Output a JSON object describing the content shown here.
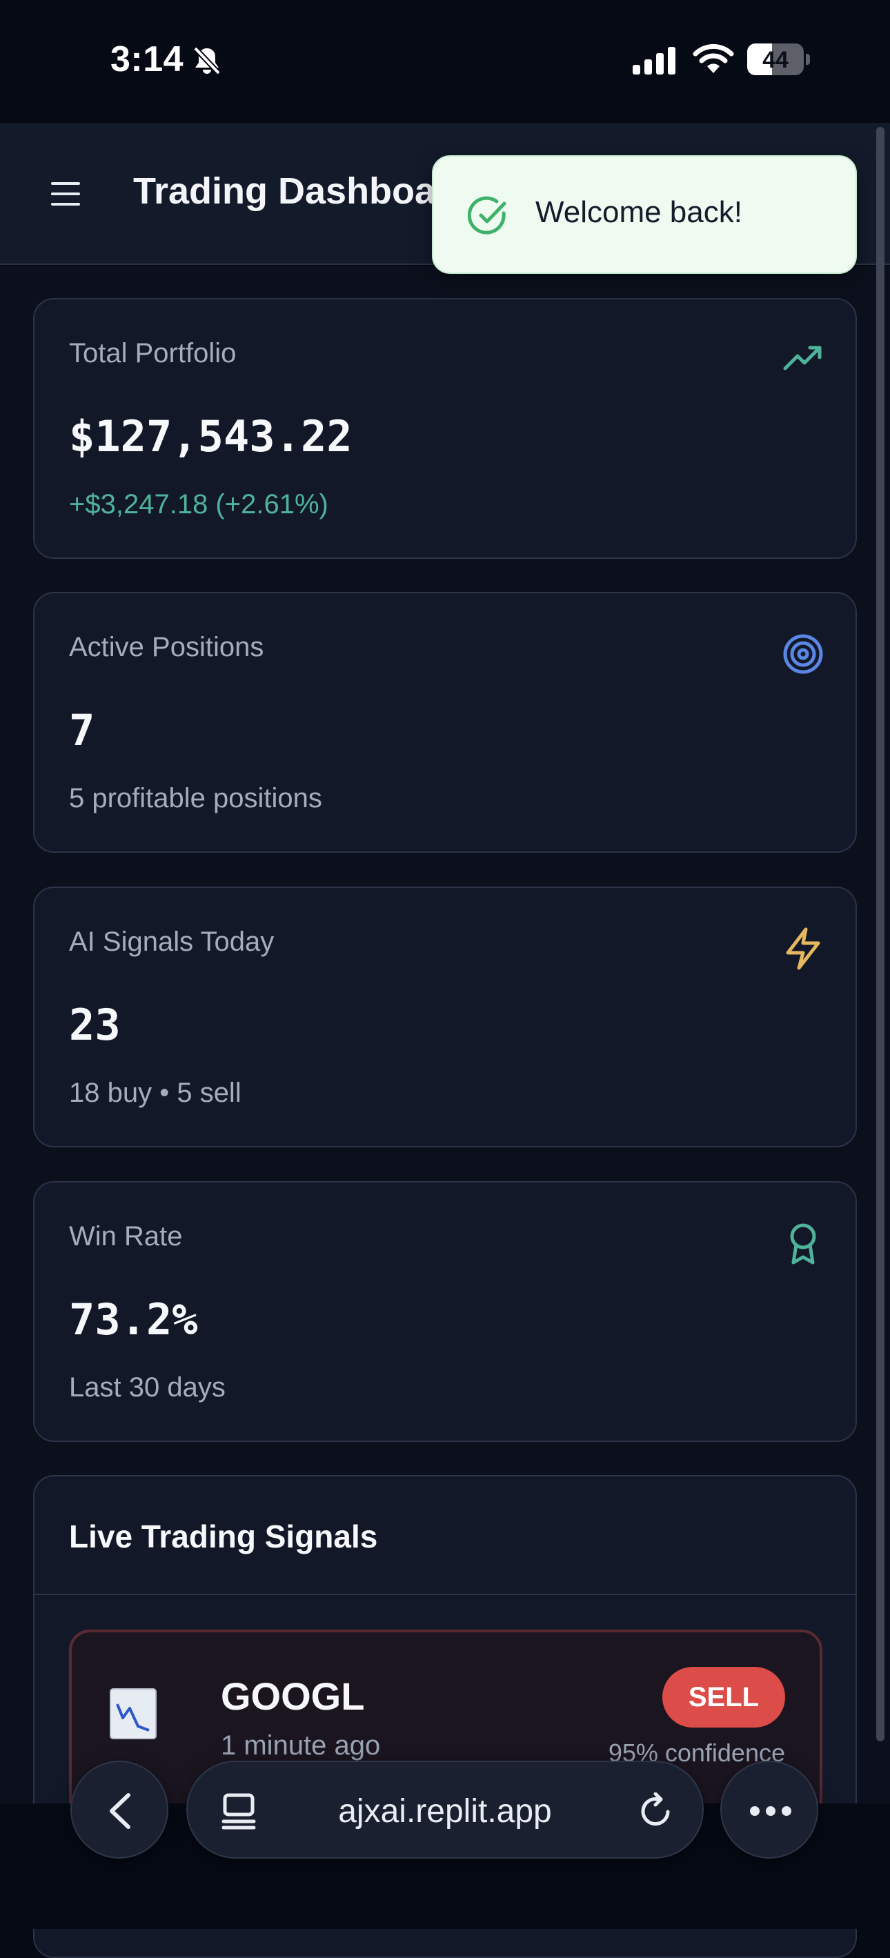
{
  "status_bar": {
    "time": "3:14",
    "battery": "44",
    "battery_level": 0.44,
    "icons": [
      "bell-slash-icon",
      "signal-icon",
      "wifi-icon",
      "battery-icon"
    ]
  },
  "header": {
    "title": "Trading Dashboard",
    "menu_icon": "hamburger-menu-icon"
  },
  "toast": {
    "message": "Welcome back!",
    "icon": "check-circle-icon"
  },
  "cards": [
    {
      "label": "Total Portfolio",
      "value": "$127,543.22",
      "sub": "+$3,247.18  (+2.61%)",
      "icon": "trending-up-icon",
      "icon_color": "#4fb29a"
    },
    {
      "label": "Active Positions",
      "value": "7",
      "sub": "5 profitable positions",
      "icon": "target-icon",
      "icon_color": "#5b86e5"
    },
    {
      "label": "AI Signals Today",
      "value": "23",
      "sub": "18 buy • 5 sell",
      "icon": "lightning-icon",
      "icon_color": "#e5b860"
    },
    {
      "label": "Win Rate",
      "value": "73.2%",
      "sub": "Last 30 days",
      "icon": "award-icon",
      "icon_color": "#4fb29a"
    }
  ],
  "signals": {
    "title": "Live Trading Signals",
    "items": [
      {
        "symbol": "GOOGL",
        "time": "1 minute ago",
        "action": "SELL",
        "confidence": "95% confidence",
        "icon": "chart-down-icon"
      }
    ]
  },
  "browser": {
    "url": "ajxai.replit.app",
    "icons": [
      "back-icon",
      "tabs-icon",
      "reload-icon",
      "more-icon"
    ]
  },
  "colors": {
    "positive": "#4fb29a",
    "sell": "#dc4c48",
    "background": "#0b101c",
    "card": "#121827"
  }
}
